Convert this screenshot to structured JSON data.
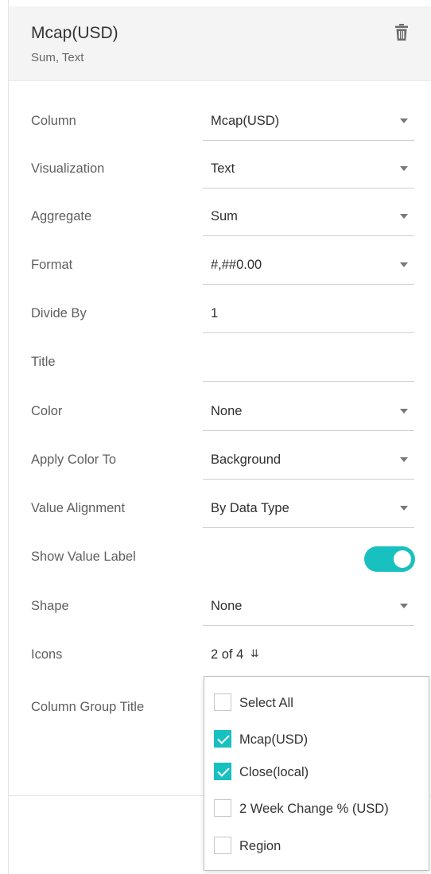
{
  "header": {
    "title": "Mcap(USD)",
    "subtitle": "Sum, Text"
  },
  "fields": {
    "column": {
      "label": "Column",
      "value": "Mcap(USD)"
    },
    "visualization": {
      "label": "Visualization",
      "value": "Text"
    },
    "aggregate": {
      "label": "Aggregate",
      "value": "Sum"
    },
    "format": {
      "label": "Format",
      "value": "#,##0.00"
    },
    "divide_by": {
      "label": "Divide By",
      "value": "1"
    },
    "title": {
      "label": "Title",
      "value": ""
    },
    "color": {
      "label": "Color",
      "value": "None"
    },
    "apply_color_to": {
      "label": "Apply Color To",
      "value": "Background"
    },
    "value_alignment": {
      "label": "Value Alignment",
      "value": "By Data Type"
    },
    "show_value_label": {
      "label": "Show Value Label",
      "on": true
    },
    "shape": {
      "label": "Shape",
      "value": "None"
    },
    "icons": {
      "label": "Icons",
      "value": "2 of 4",
      "chevron": "»"
    },
    "column_group_title": {
      "label": "Column Group Title"
    }
  },
  "icons_dropdown": {
    "options": [
      {
        "label": "Select All",
        "checked": false
      },
      {
        "label": "Mcap(USD)",
        "checked": true
      },
      {
        "label": "Close(local)",
        "checked": true
      },
      {
        "label": "2 Week Change % (USD)",
        "checked": false
      },
      {
        "label": "Region",
        "checked": false
      }
    ]
  },
  "colors": {
    "accent": "#19c0c0",
    "header_bg": "#f4f4f4"
  }
}
